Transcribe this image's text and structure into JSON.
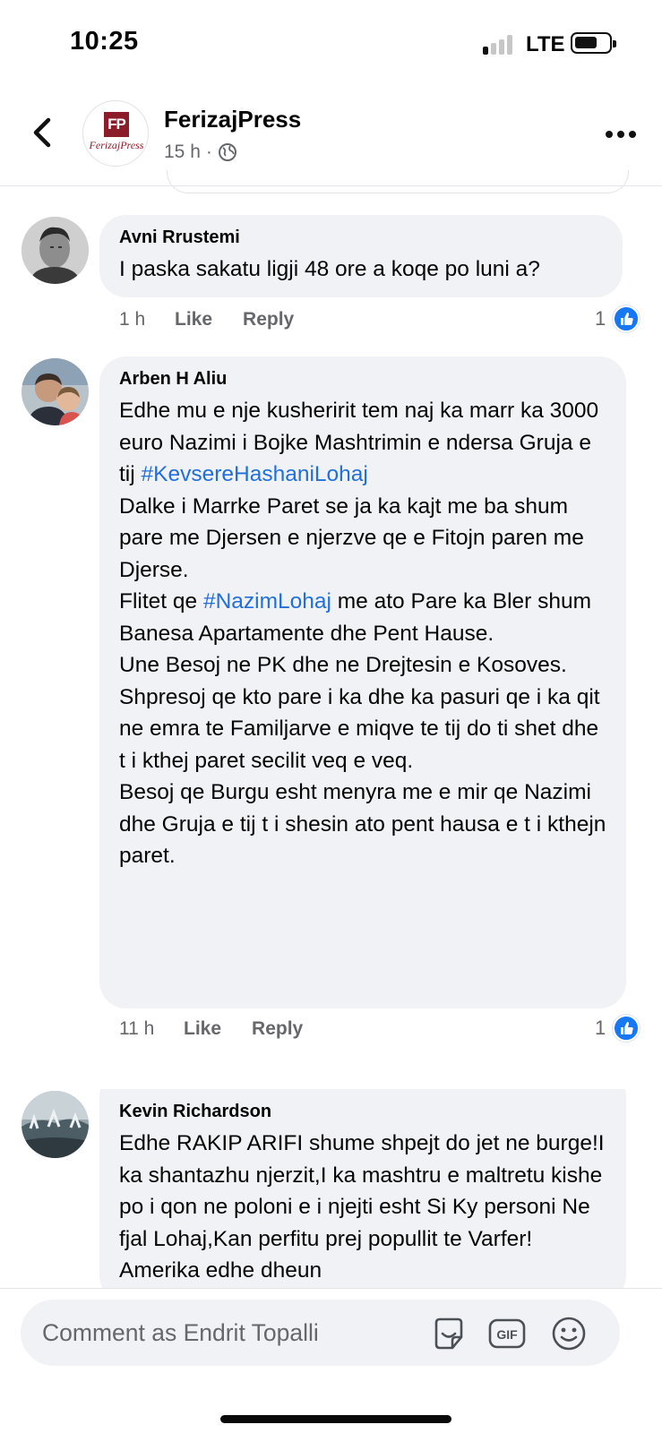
{
  "status_bar": {
    "time": "10:25",
    "network": "LTE",
    "signal_bars_on": 1,
    "signal_bars_total": 4
  },
  "header": {
    "page_name": "FerizajPress",
    "logo_mark": "FP",
    "logo_text": "FerizajPress",
    "time_ago": "15 h",
    "separator": "·",
    "audience_icon": "globe-icon"
  },
  "comments": [
    {
      "author": "Avni Rrustemi",
      "text": "I paska sakatu ligji 48 ore a koqe po luni a?",
      "time": "1 h",
      "like_label": "Like",
      "reply_label": "Reply",
      "reaction_count": "1"
    },
    {
      "author": "Arben H Aliu",
      "text_parts": [
        "Edhe mu e nje kusheririt tem naj ka marr ka 3000 euro Nazimi i Bojke Mashtrimin e ndersa Gruja e tij ",
        "#KevsereHashaniLohaj",
        "\nDalke i Marrke Paret se ja ka kajt me ba shum pare me Djersen e njerzve qe e Fitojn paren me Djerse.\nFlitet qe ",
        "#NazimLohaj",
        " me ato Pare ka Bler shum Banesa Apartamente dhe Pent Hause.\nUne Besoj ne PK dhe ne Drejtesin e Kosoves.\nShpresoj qe kto pare i ka dhe ka pasuri qe i ka qit ne emra te Familjarve e miqve te tij do ti shet dhe t i kthej paret secilit veq e veq.\nBesoj qe Burgu esht menyra me e mir qe Nazimi dhe Gruja e tij t i shesin ato pent hausa e t i kthejn paret."
      ],
      "time": "11 h",
      "like_label": "Like",
      "reply_label": "Reply",
      "reaction_count": "1"
    },
    {
      "author": "Kevin Richardson",
      "text": "Edhe RAKIP ARIFI shume shpejt do jet ne burge!I ka shantazhu njerzit,I ka mashtru e maltretu kishe po i qon ne poloni e i njejti esht Si Ky personi Ne fjal Lohaj,Kan perfitu prej popullit te Varfer! Amerika edhe dheun"
    }
  ],
  "composer": {
    "placeholder": "Comment as Endrit Topalli",
    "gif_label": "GIF"
  },
  "colors": {
    "hashtag": "#216fdb",
    "like_blue": "#1877f2",
    "bubble": "#f0f2f5",
    "meta_gray": "#65676b",
    "logo_red": "#8c1c2a"
  }
}
